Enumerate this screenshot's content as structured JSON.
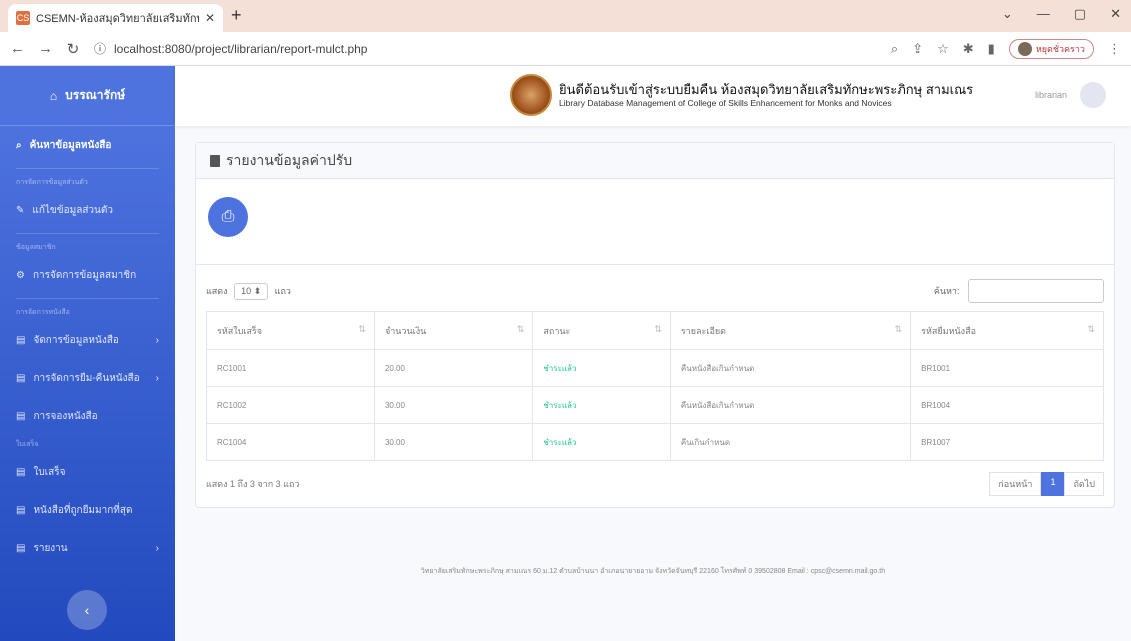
{
  "browser": {
    "tab_title": "CSEMN-ห้องสมุดวิทยาลัยเสริมทักษะ",
    "favicon": "CS",
    "url": "localhost:8080/project/librarian/report-mulct.php",
    "profile_label": "หยุดชั่วคราว"
  },
  "sidebar": {
    "brand": "บรรณารักษ์",
    "items": [
      {
        "label": "ค้นหาข้อมูลหนังสือ",
        "icon": "search-icon"
      },
      {
        "heading": "การจัดการข้อมูลส่วนตัว"
      },
      {
        "label": "แก้ไขข้อมูลส่วนตัว",
        "icon": "edit-icon"
      },
      {
        "heading": "ข้อมูลสมาชิก"
      },
      {
        "label": "การจัดการข้อมูลสมาชิก",
        "icon": "gear-icon"
      },
      {
        "heading": "การจัดการหนังสือ"
      },
      {
        "label": "จัดการข้อมูลหนังสือ",
        "icon": "book-icon"
      },
      {
        "label": "การจัดการยืม-คืนหนังสือ",
        "icon": "book-icon"
      },
      {
        "label": "การจองหนังสือ",
        "icon": "book-icon"
      },
      {
        "heading": "ใบเสร็จ"
      },
      {
        "label": "ใบเสร็จ",
        "icon": "receipt-icon"
      },
      {
        "label": "หนังสือที่ถูกยืมมากที่สุด",
        "icon": "chart-icon"
      },
      {
        "label": "รายงาน",
        "icon": "report-icon"
      }
    ]
  },
  "topbar": {
    "title": "ยินดีต้อนรับเข้าสู่ระบบยืมคืน ห้องสมุดวิทยาลัยเสริมทักษะพระภิกษุ สามเณร",
    "subtitle": "Library Database Management of College of Skills Enhancement for Monks and Novices",
    "user": "librarian"
  },
  "page": {
    "heading": "รายงานข้อมูลค่าปรับ",
    "show_label": "แสดง",
    "show_value": "10",
    "rows_label": "แถว",
    "search_label": "ค้นหา:",
    "columns": [
      "รหัสใบเสร็จ",
      "จำนวนเงิน",
      "สถานะ",
      "รายละเอียด",
      "รหัสยืมหนังสือ"
    ],
    "rows": [
      [
        "RC1001",
        "20.00",
        "ชำระแล้ว",
        "คืนหนังสือเกินกำหนด",
        "BR1001"
      ],
      [
        "RC1002",
        "30.00",
        "ชำระแล้ว",
        "คืนหนังสือเกินกำหนด",
        "BR1004"
      ],
      [
        "RC1004",
        "30.00",
        "ชำระแล้ว",
        "คืนเกินกำหนด",
        "BR1007"
      ]
    ],
    "info": "แสดง 1 ถึง 3 จาก 3 แถว",
    "prev": "ก่อนหน้า",
    "page_num": "1",
    "next": "ถัดไป"
  },
  "footer": {
    "text": "วิทยาลัยเสริมทักษะพระภิกษุ สามเณร 60 ม.12 ตำบลบ้านนา อำเภอนายายอาม จังหวัดจันทบุรี 22160 โทรศัพท์ 0 39502808 Email : cpsc@csemn.mail.go.th"
  }
}
